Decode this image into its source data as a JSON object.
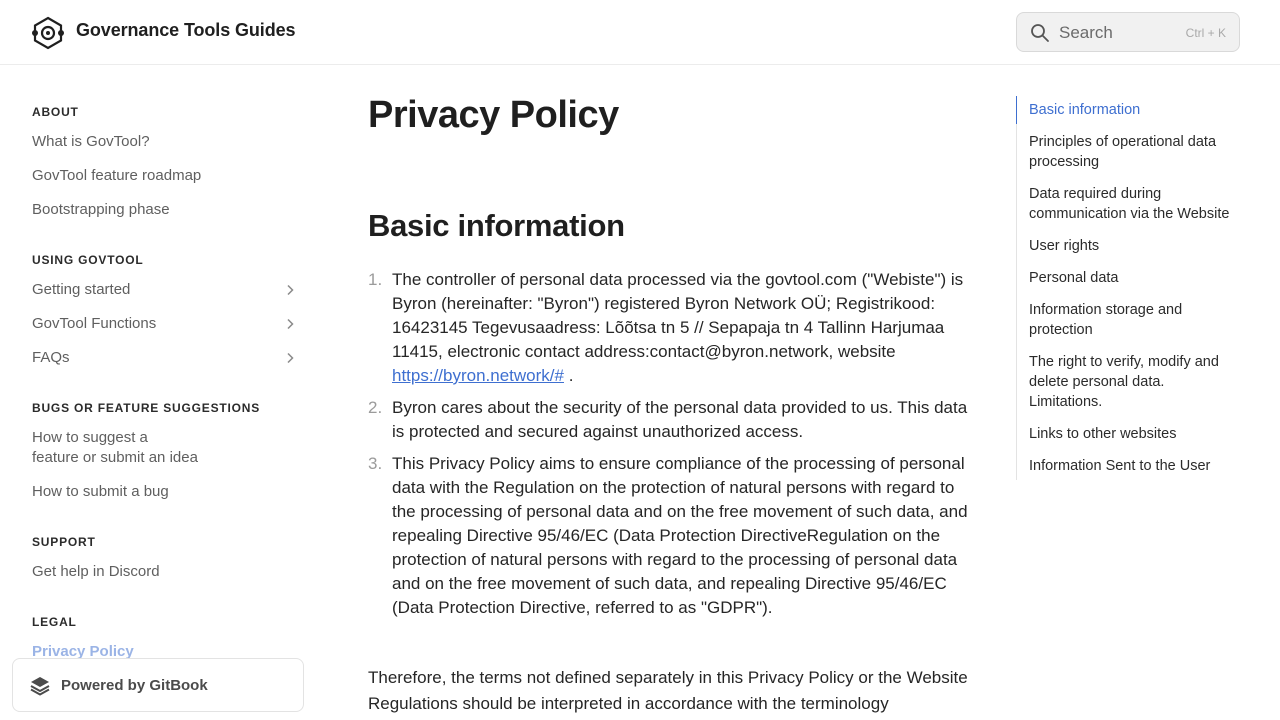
{
  "header": {
    "site_title": "Governance Tools Guides",
    "search_placeholder": "Search",
    "search_shortcut": "Ctrl + K"
  },
  "sidebar": {
    "sections": [
      {
        "title": "ABOUT",
        "items": [
          {
            "label": "What is GovTool?"
          },
          {
            "label": "GovTool feature roadmap"
          },
          {
            "label": "Bootstrapping phase"
          }
        ]
      },
      {
        "title": "USING GOVTOOL",
        "items": [
          {
            "label": "Getting started",
            "expandable": true
          },
          {
            "label": "GovTool Functions",
            "expandable": true
          },
          {
            "label": "FAQs",
            "expandable": true
          }
        ]
      },
      {
        "title": "BUGS OR FEATURE SUGGESTIONS",
        "items": [
          {
            "label_line1": "How to suggest a",
            "label_line2": "feature or submit an idea"
          },
          {
            "label": "How to submit a bug"
          }
        ]
      },
      {
        "title": "SUPPORT",
        "items": [
          {
            "label": "Get help in Discord"
          }
        ]
      },
      {
        "title": "LEGAL",
        "items": [
          {
            "label": "Privacy Policy",
            "active": true
          }
        ]
      }
    ],
    "powered_by": "Powered by GitBook"
  },
  "main": {
    "page_title": "Privacy Policy",
    "section_heading": "Basic information",
    "list": [
      {
        "num": "1.",
        "text": "The controller of personal data processed via the govtool.com (\"Webiste\") is Byron (hereinafter: \"Byron\") registered Byron Network OÜ; Registrikood: 16423145 Tegevusaadress: Lõõtsa tn 5 // Sepapaja tn 4 Tallinn Harjumaa 11415, electronic contact address:contact@byron.network, website",
        "link": "https://byron.network/#",
        "after": " ."
      },
      {
        "num": "2.",
        "text": "Byron cares about the security of the personal data provided to us. This data is protected and secured against unauthorized access."
      },
      {
        "num": "3.",
        "text": "This Privacy Policy aims to ensure compliance of the processing of personal data with the Regulation on the protection of natural persons with regard to the processing of personal data and on the free movement of such data, and repealing Directive 95/46/EC (Data Protection DirectiveRegulation on the protection of natural persons with regard to the processing of personal data and on the free movement of such data, and repealing Directive 95/46/EC (Data Protection Directive, referred to as \"GDPR\")."
      }
    ],
    "paragraph": "Therefore, the terms not defined separately in this Privacy Policy or the Website Regulations should be interpreted in accordance with the terminology"
  },
  "toc": {
    "items": [
      {
        "label": "Basic information",
        "active": true
      },
      {
        "label": "Principles of operational data processing"
      },
      {
        "label": "Data required during communication via the Website"
      },
      {
        "label": "User rights"
      },
      {
        "label": "Personal data"
      },
      {
        "label": "Information storage and protection"
      },
      {
        "label": "The right to verify, modify and delete personal data. Limitations."
      },
      {
        "label": "Links to other websites"
      },
      {
        "label": "Information Sent to the User"
      }
    ]
  },
  "colors": {
    "accent": "#3e6fd0",
    "active_sidebar": "#9bb4e6",
    "text": "#1f1f1f",
    "muted": "#5f5f5f"
  },
  "icons": [
    "logo-icon",
    "search-icon",
    "chevron-right-icon",
    "gitbook-icon"
  ]
}
